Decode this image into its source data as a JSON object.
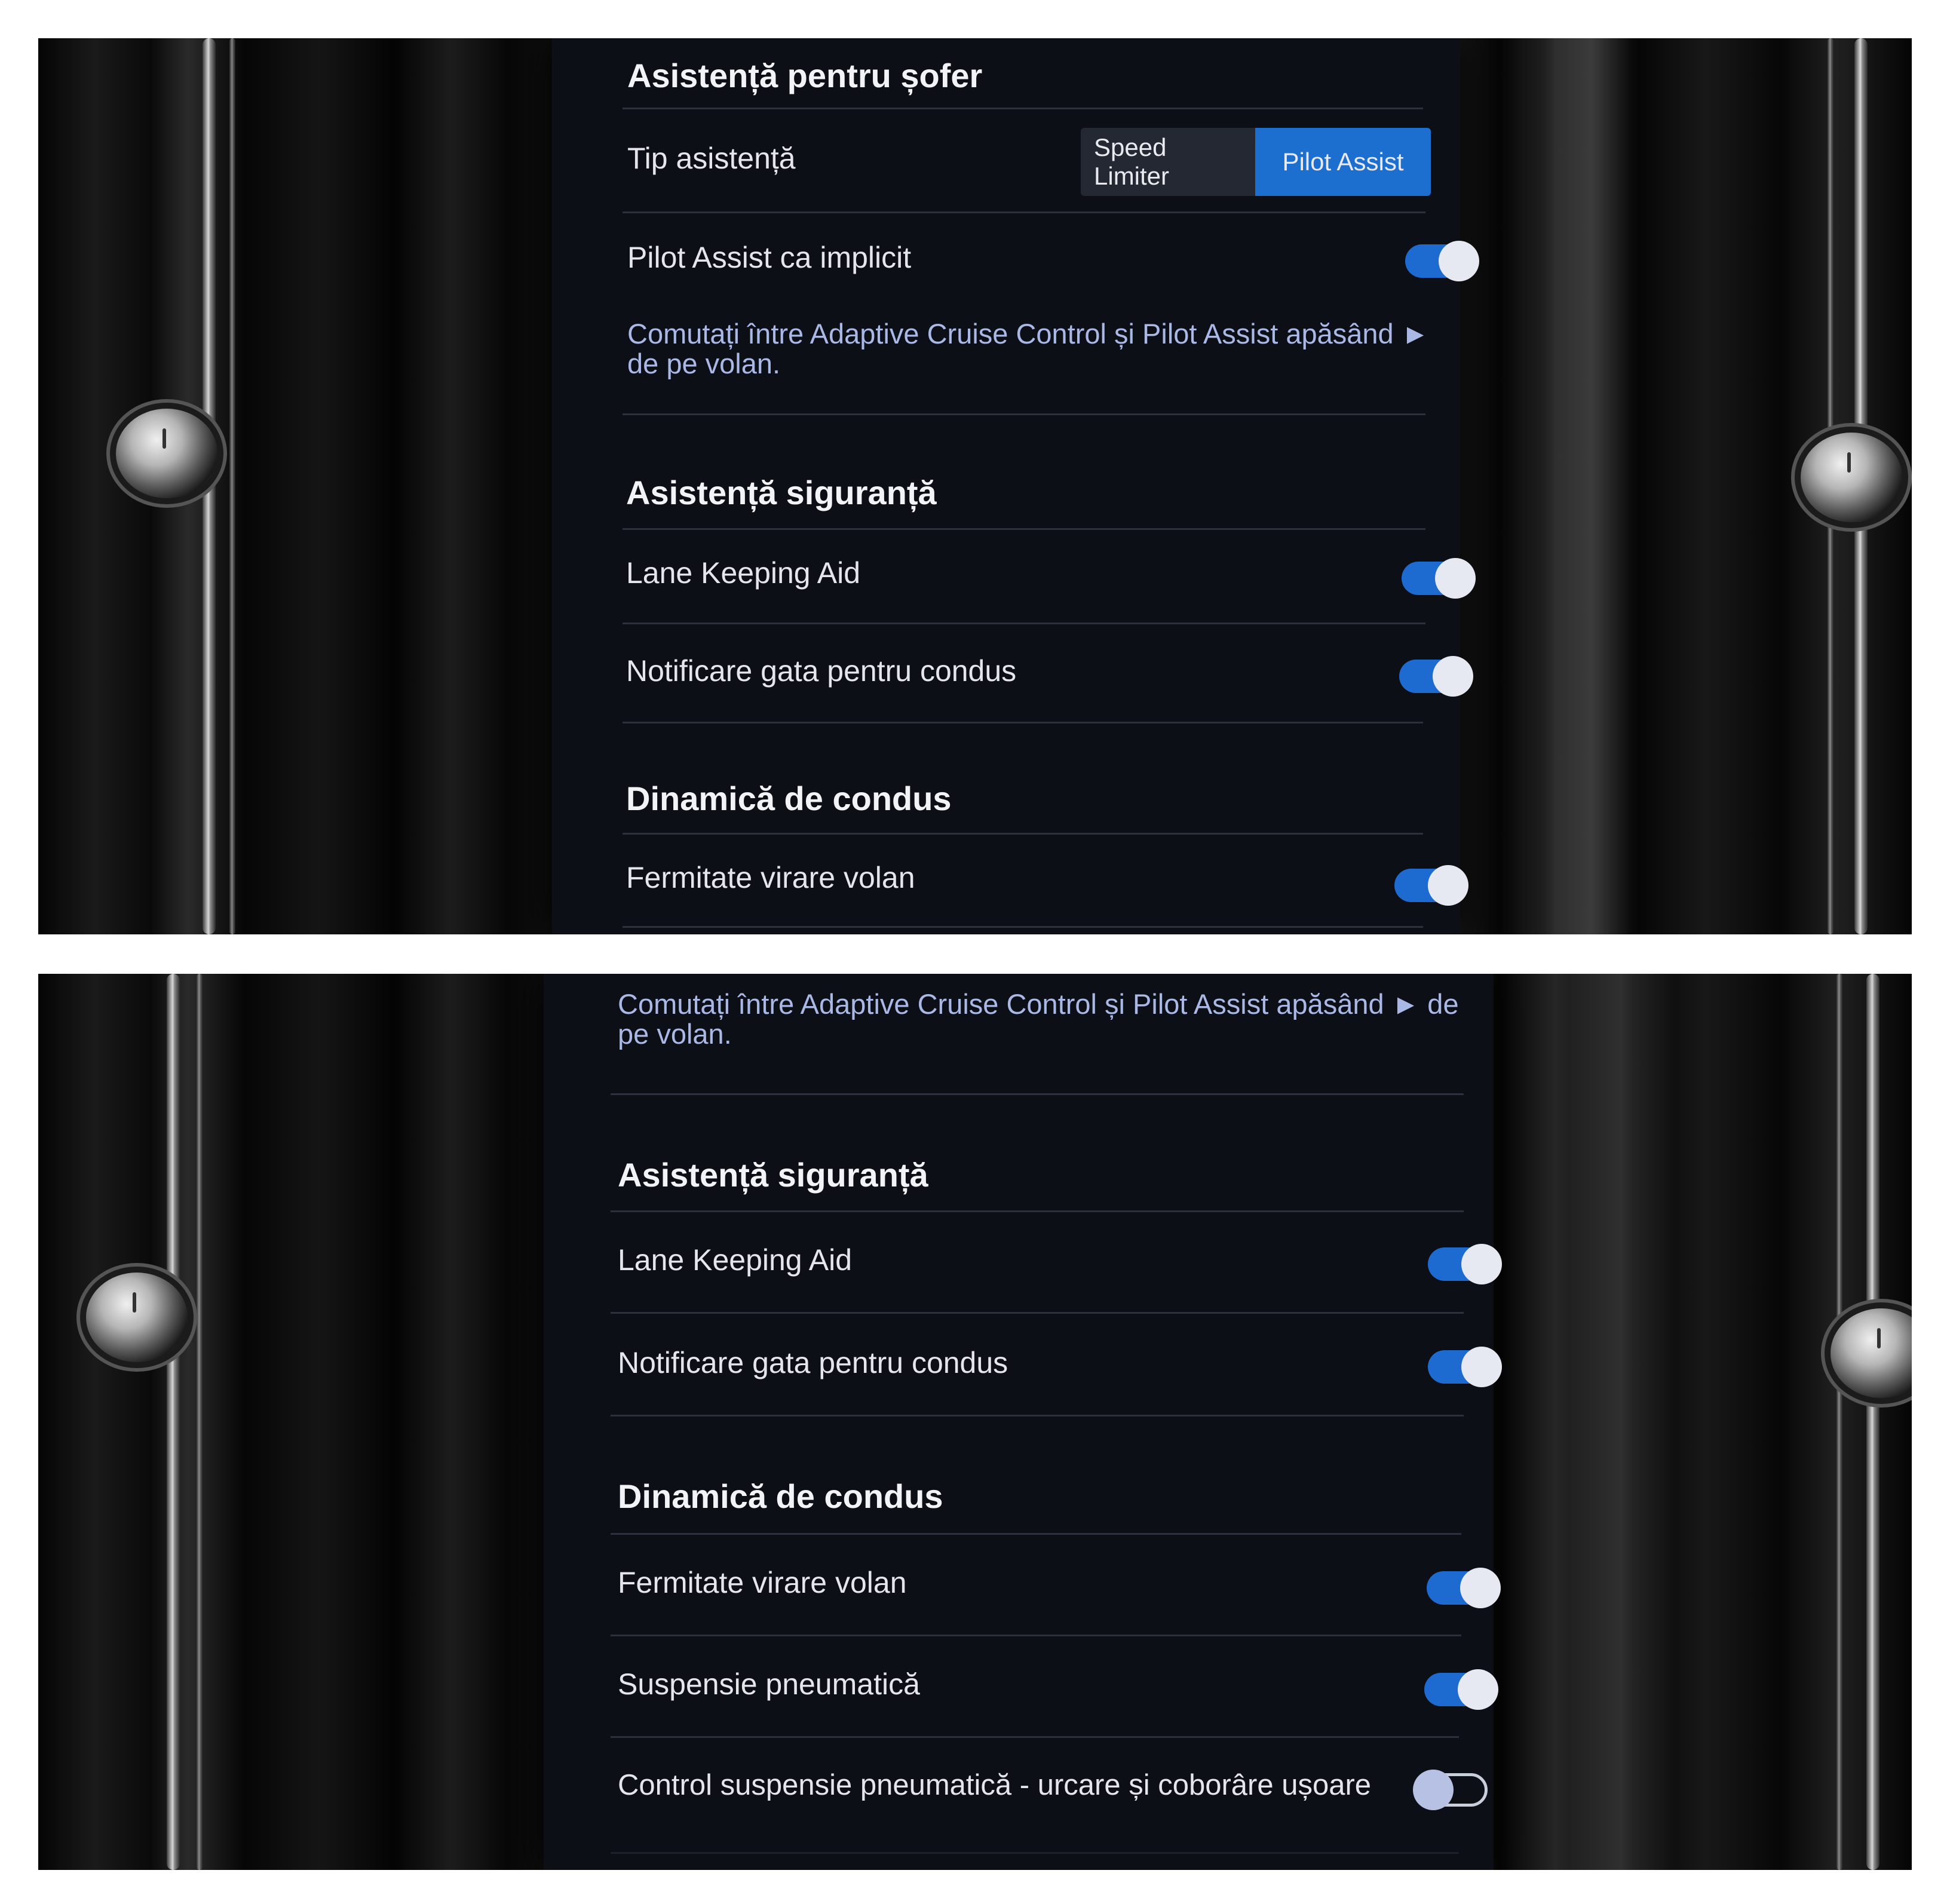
{
  "top_screen": {
    "driver_assist": {
      "title": "Asistență pentru șofer",
      "assist_type_label": "Tip asistență",
      "assist_options": [
        "Speed Limiter",
        "Pilot Assist"
      ],
      "assist_selected": "Pilot Assist",
      "pilot_default_label": "Pilot Assist ca implicit",
      "pilot_default_on": true,
      "description": "Comutați între Adaptive Cruise Control și Pilot Assist apăsând ► de pe volan."
    },
    "safety": {
      "title": "Asistență siguranță",
      "lane_keeping_label": "Lane Keeping Aid",
      "lane_keeping_on": true,
      "ready_notice_label": "Notificare gata pentru condus",
      "ready_notice_on": true
    },
    "dynamics": {
      "title": "Dinamică de condus",
      "steering_label": "Fermitate virare volan",
      "steering_on": true
    }
  },
  "bottom_screen": {
    "description": "Comutați între Adaptive Cruise Control și Pilot Assist apăsând ► de pe volan.",
    "safety": {
      "title": "Asistență siguranță",
      "lane_keeping_label": "Lane Keeping Aid",
      "lane_keeping_on": true,
      "ready_notice_label": "Notificare gata pentru condus",
      "ready_notice_on": true
    },
    "dynamics": {
      "title": "Dinamică de condus",
      "steering_label": "Fermitate virare volan",
      "steering_on": true,
      "air_suspension_label": "Suspensie pneumatică",
      "air_suspension_on": true,
      "air_suspension_control_label": "Control suspensie pneumatică - urcare și coborâre ușoare",
      "air_suspension_control_on": false
    }
  },
  "colors": {
    "toggle_on": "#1d6ad0",
    "segment_active": "#1c6ecf",
    "screen_bg": "#0d0f16",
    "description_text": "#aab8e6"
  }
}
